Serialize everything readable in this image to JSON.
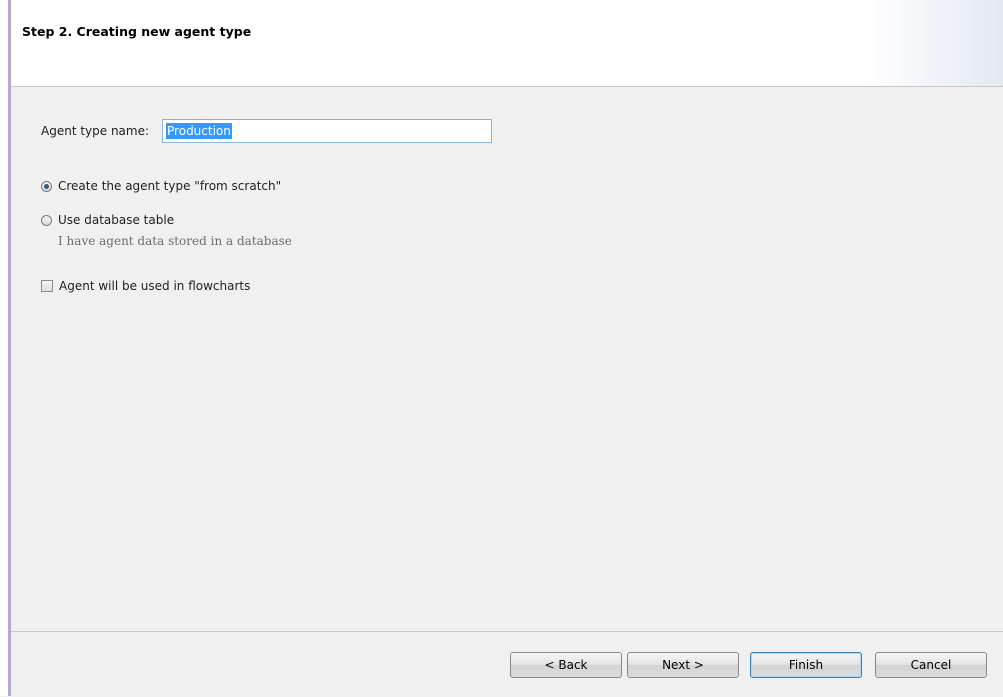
{
  "header": {
    "title": "Step 2. Creating new agent type"
  },
  "form": {
    "name_label": "Agent type name:",
    "name_value": "Production",
    "options": [
      {
        "label": "Create the agent type \"from scratch\"",
        "checked": true
      },
      {
        "label": "Use database table",
        "checked": false
      }
    ],
    "db_hint": "I have agent data stored in a database",
    "flowchart_label": "Agent will be used in flowcharts",
    "flowchart_checked": false
  },
  "buttons": {
    "back": "< Back",
    "next": "Next >",
    "finish": "Finish",
    "cancel": "Cancel"
  }
}
